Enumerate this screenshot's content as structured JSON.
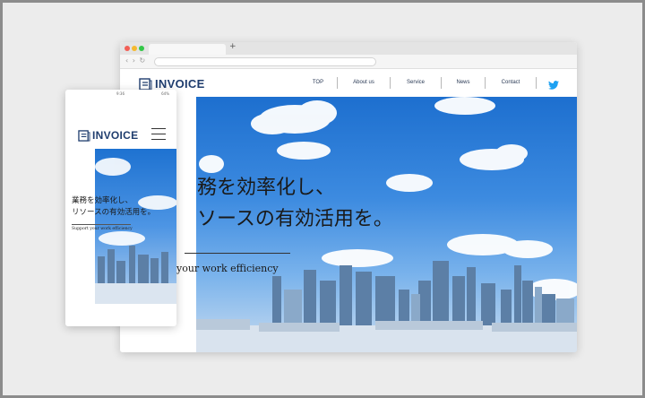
{
  "desktop": {
    "brand": "INVOICE",
    "nav": [
      {
        "label": "TOP"
      },
      {
        "label": "About us"
      },
      {
        "label": "Service"
      },
      {
        "label": "News"
      },
      {
        "label": "Contact"
      }
    ],
    "headline_line1": "務を効率化し、",
    "headline_line2": "ソースの有効活用を。",
    "tagline": "your work efficiency",
    "new_tab": "+"
  },
  "mobile": {
    "brand": "INVOICE",
    "status_time": "9:36",
    "status_battery": "64%",
    "headline_line1": "業務を効率化し、",
    "headline_line2": "リソースの有効活用を。",
    "tagline": "Support your work efficiency"
  },
  "colors": {
    "brand": "#1f3d6e",
    "twitter": "#1da1f2",
    "sky_top": "#1d6fcf"
  },
  "icons": [
    "document-logo-icon",
    "twitter-icon",
    "hamburger-menu-icon"
  ]
}
